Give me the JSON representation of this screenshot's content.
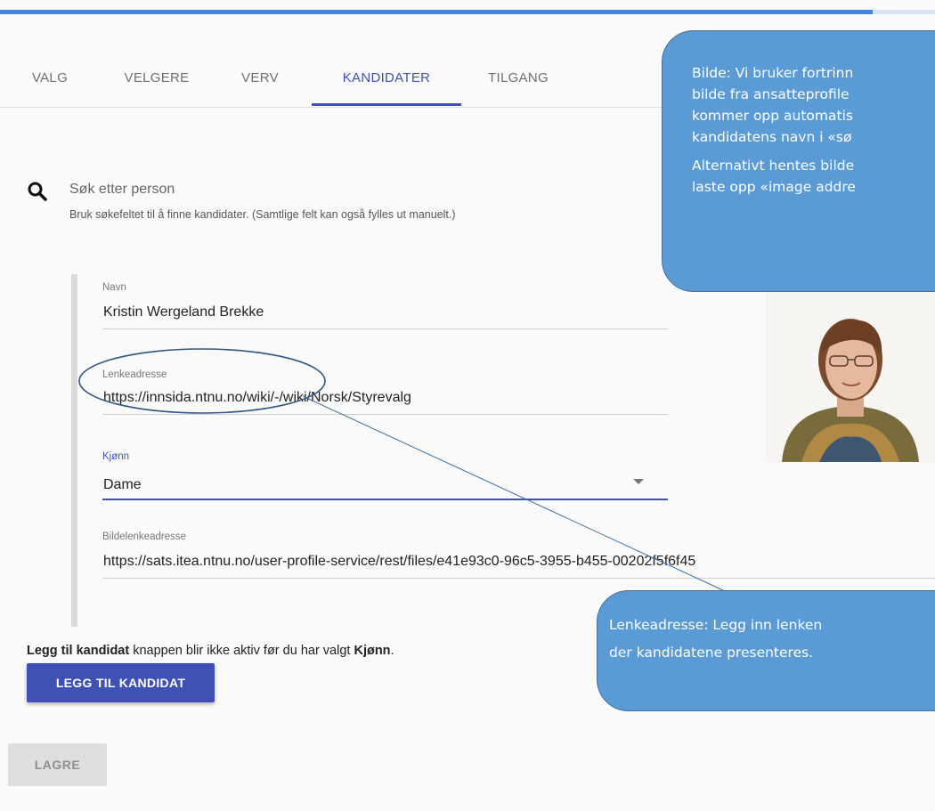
{
  "progress": {
    "fraction": 0.933,
    "color": "#3f86e8"
  },
  "tabs": [
    {
      "label": "VALG"
    },
    {
      "label": "VELGERE"
    },
    {
      "label": "VERV"
    },
    {
      "label": "KANDIDATER",
      "active": true
    },
    {
      "label": "TILGANG"
    }
  ],
  "search": {
    "icon": "search-icon",
    "placeholder": "Søk etter person",
    "hint": "Bruk søkefeltet til å finne kandidater. (Samtlige felt kan også fylles ut manuelt.)"
  },
  "form": {
    "navn": {
      "label": "Navn",
      "value": "Kristin Wergeland Brekke"
    },
    "lenke": {
      "label": "Lenkeadresse",
      "value": "https://innsida.ntnu.no/wiki/-/wiki/Norsk/Styrevalg"
    },
    "kjonn": {
      "label": "Kjønn",
      "value": "Dame"
    },
    "bilde": {
      "label": "Bildelenkeadresse",
      "value": "https://sats.itea.ntnu.no/user-profile-service/rest/files/e41e93c0-96c5-3955-b455-00202f5f6f45"
    }
  },
  "info": {
    "part1": "Legg til kandidat",
    "part2": " knappen blir ikke aktiv før du har valgt ",
    "part3": "Kjønn",
    "part4": "."
  },
  "buttons": {
    "add": "LEGG TIL KANDIDAT",
    "save": "LAGRE"
  },
  "callouts": {
    "top": [
      [
        "Bilde: Vi bruker fortrinn",
        "bilde fra ansatteprofile",
        "kommer opp automatis",
        "kandidatens navn i «sø"
      ],
      [
        "Alternativt hentes bilde",
        "laste opp «image addre"
      ]
    ],
    "bottom": [
      "Lenkeadresse: Legg inn lenken",
      "der kandidatene presenteres."
    ]
  },
  "colors": {
    "primary": "#3f51b5",
    "callout": "#5b9bd5",
    "callout_border": "#41719c"
  }
}
